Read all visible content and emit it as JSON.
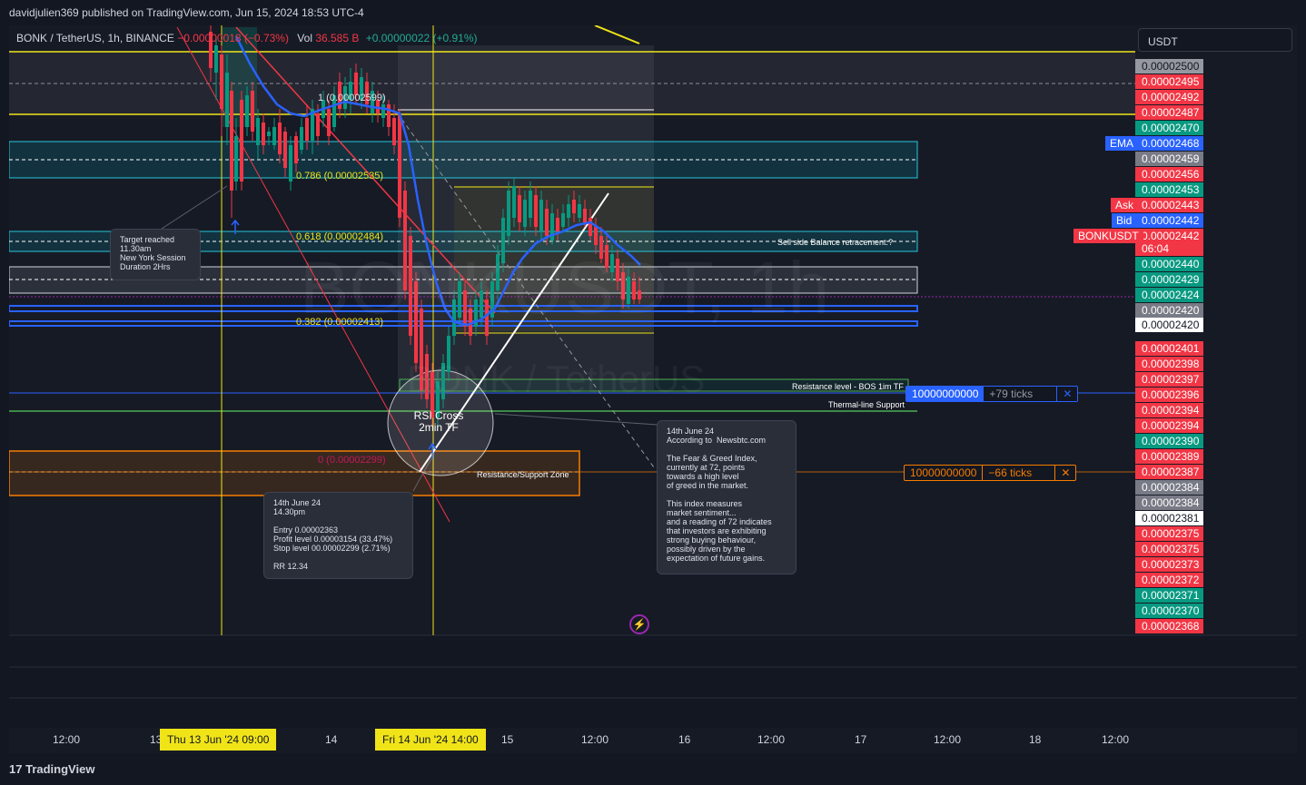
{
  "publish": {
    "text": "davidjulien369 published on TradingView.com, Jun 15, 2024 18:53 UTC-4"
  },
  "symbol": {
    "name": "BONK / TetherUS, 1h, BINANCE",
    "change": "−0.00000018 (−0.73%)",
    "vol_label": "Vol",
    "vol_value": "36.585 B",
    "vol_change": "+0.00000022 (+0.91%)"
  },
  "currency": "USDT",
  "watermark": {
    "line1": "BONKUSDT, 1h",
    "line2": "BONK / TetherUS"
  },
  "price_labels": [
    {
      "text": "0.00002500",
      "bg": "#9598a1",
      "fg": "#131722"
    },
    {
      "text": "0.00002495",
      "bg": "#f23645",
      "fg": "#ffffff"
    },
    {
      "text": "0.00002492",
      "bg": "#f23645",
      "fg": "#ffffff"
    },
    {
      "text": "0.00002487",
      "bg": "#f23645",
      "fg": "#ffffff"
    },
    {
      "text": "0.00002470",
      "bg": "#089981",
      "fg": "#ffffff"
    },
    {
      "text": "0.00002468",
      "bg": "#2962ff",
      "fg": "#ffffff"
    },
    {
      "text": "0.00002459",
      "bg": "#787b86",
      "fg": "#ffffff"
    },
    {
      "text": "0.00002456",
      "bg": "#f23645",
      "fg": "#ffffff"
    },
    {
      "text": "0.00002453",
      "bg": "#089981",
      "fg": "#ffffff"
    },
    {
      "text": "0.00002443",
      "bg": "#f23645",
      "fg": "#ffffff"
    },
    {
      "text": "0.00002442",
      "bg": "#2962ff",
      "fg": "#ffffff"
    },
    {
      "text": "0.00002442",
      "bg": "#f23645",
      "fg": "#ffffff"
    },
    {
      "text": "06:04",
      "bg": "#f23645",
      "fg": "#ffffff"
    },
    {
      "text": "0.00002440",
      "bg": "#089981",
      "fg": "#ffffff"
    },
    {
      "text": "0.00002429",
      "bg": "#089981",
      "fg": "#ffffff"
    },
    {
      "text": "0.00002424",
      "bg": "#089981",
      "fg": "#ffffff"
    },
    {
      "text": "0.00002420",
      "bg": "#787b86",
      "fg": "#ffffff"
    },
    {
      "text": "0.00002420",
      "bg": "#ffffff",
      "fg": "#131722"
    },
    {
      "text": "0.00002401",
      "bg": "#f23645",
      "fg": "#ffffff"
    },
    {
      "text": "0.00002398",
      "bg": "#f23645",
      "fg": "#ffffff"
    },
    {
      "text": "0.00002397",
      "bg": "#f23645",
      "fg": "#ffffff"
    },
    {
      "text": "0.00002396",
      "bg": "#f23645",
      "fg": "#ffffff"
    },
    {
      "text": "0.00002394",
      "bg": "#f23645",
      "fg": "#ffffff"
    },
    {
      "text": "0.00002394",
      "bg": "#f23645",
      "fg": "#ffffff"
    },
    {
      "text": "0.00002390",
      "bg": "#089981",
      "fg": "#ffffff"
    },
    {
      "text": "0.00002389",
      "bg": "#f23645",
      "fg": "#ffffff"
    },
    {
      "text": "0.00002387",
      "bg": "#f23645",
      "fg": "#ffffff"
    },
    {
      "text": "0.00002384",
      "bg": "#787b86",
      "fg": "#ffffff"
    },
    {
      "text": "0.00002384",
      "bg": "#787b86",
      "fg": "#ffffff"
    },
    {
      "text": "0.00002381",
      "bg": "#ffffff",
      "fg": "#131722"
    },
    {
      "text": "0.00002375",
      "bg": "#f23645",
      "fg": "#ffffff"
    },
    {
      "text": "0.00002375",
      "bg": "#f23645",
      "fg": "#ffffff"
    },
    {
      "text": "0.00002373",
      "bg": "#f23645",
      "fg": "#ffffff"
    },
    {
      "text": "0.00002372",
      "bg": "#f23645",
      "fg": "#ffffff"
    },
    {
      "text": "0.00002371",
      "bg": "#089981",
      "fg": "#ffffff"
    },
    {
      "text": "0.00002370",
      "bg": "#089981",
      "fg": "#ffffff"
    },
    {
      "text": "0.00002368",
      "bg": "#f23645",
      "fg": "#ffffff"
    }
  ],
  "tags": {
    "ema": "EMA",
    "ask": "Ask",
    "bid": "Bid",
    "symbol": "BONKUSDT"
  },
  "time_axis": [
    "12:00",
    "13",
    "Thu 13 Jun '24   09:00",
    "14",
    "Fri 14 Jun '24   14:00",
    "15",
    "12:00",
    "16",
    "12:00",
    "17",
    "12:00",
    "18",
    "12:00"
  ],
  "fib": {
    "l1": "1 (0.00002599)",
    "l786": "0.786 (0.00002535)",
    "l618": "0.618 (0.00002484)",
    "l382": "0.382 (0.00002413)",
    "l0": "0 (0.00002299)"
  },
  "drawings": {
    "sell_side": "Sell side Balance retracement.?",
    "resistance": "Resistance level - BOS 1im TF",
    "thermal": "Thermal-line Support",
    "res_sup_zone": "Resistance/Support Zone",
    "rsi_cross": "RSI Cross\n2min TF"
  },
  "callouts": {
    "target": "Target reached\n11.30am\nNew York Session\nDuration 2Hrs",
    "trade": "14th June 24\n14.30pm\n\nEntry 0.00002363\nProfit level 0.00003154 (33.47%)\nStop level 00.00002299 (2.71%)\n\nRR 12.34",
    "news": "14th June 24\nAccording to  Newsbtc.com\n\nThe Fear & Greed Index,\ncurrently at 72, points\ntowards a high level\nof greed in the market.\n\nThis index measures\nmarket sentiment...\nand a reading of 72 indicates\nthat investors are exhibiting\nstrong buying behaviour,\npossibly driven by the\nexpectation of future gains."
  },
  "ticks": {
    "blue_qty": "10000000000",
    "blue_ticks": "+79 ticks",
    "orange_qty": "10000000000",
    "orange_ticks": "−66 ticks",
    "close": "✕"
  },
  "colors": {
    "up": "#089981",
    "down": "#f23645",
    "ema": "#2962ff",
    "fib": "#f0e418",
    "accent": "#2962ff"
  },
  "footer": {
    "logo": "TradingView"
  },
  "icons": {
    "flash": "⚡",
    "logo": "17"
  }
}
